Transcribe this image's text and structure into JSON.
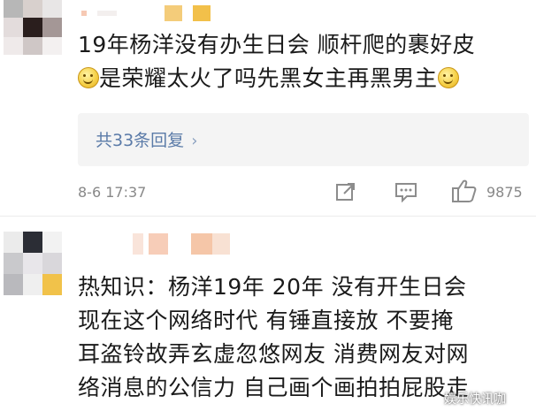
{
  "comments": [
    {
      "lines": [
        "19年杨洋没有办生日会 顺杆爬的裹好皮",
        "是荣耀太火了吗先黑女主再黑男主"
      ],
      "replies_label": "共33条回复",
      "timestamp": "8-6 17:37",
      "like_count": "9875"
    },
    {
      "lines": [
        "热知识：杨洋19年 20年 没有开生日会",
        "现在这个网络时代  有锤直接放  不要掩",
        "耳盗铃故弄玄虚忽悠网友  消费网友对网",
        "络消息的公信力  自己画个画拍拍屁股走"
      ]
    }
  ],
  "watermark": "娱乐快讯咖",
  "icons": [
    "share-icon",
    "comment-icon",
    "like-icon",
    "smile-emoji-icon",
    "chevron-right-icon"
  ],
  "colors": {
    "link": "#5b7ba8",
    "meta": "#888888",
    "reply_bg": "#f4f4f4"
  }
}
